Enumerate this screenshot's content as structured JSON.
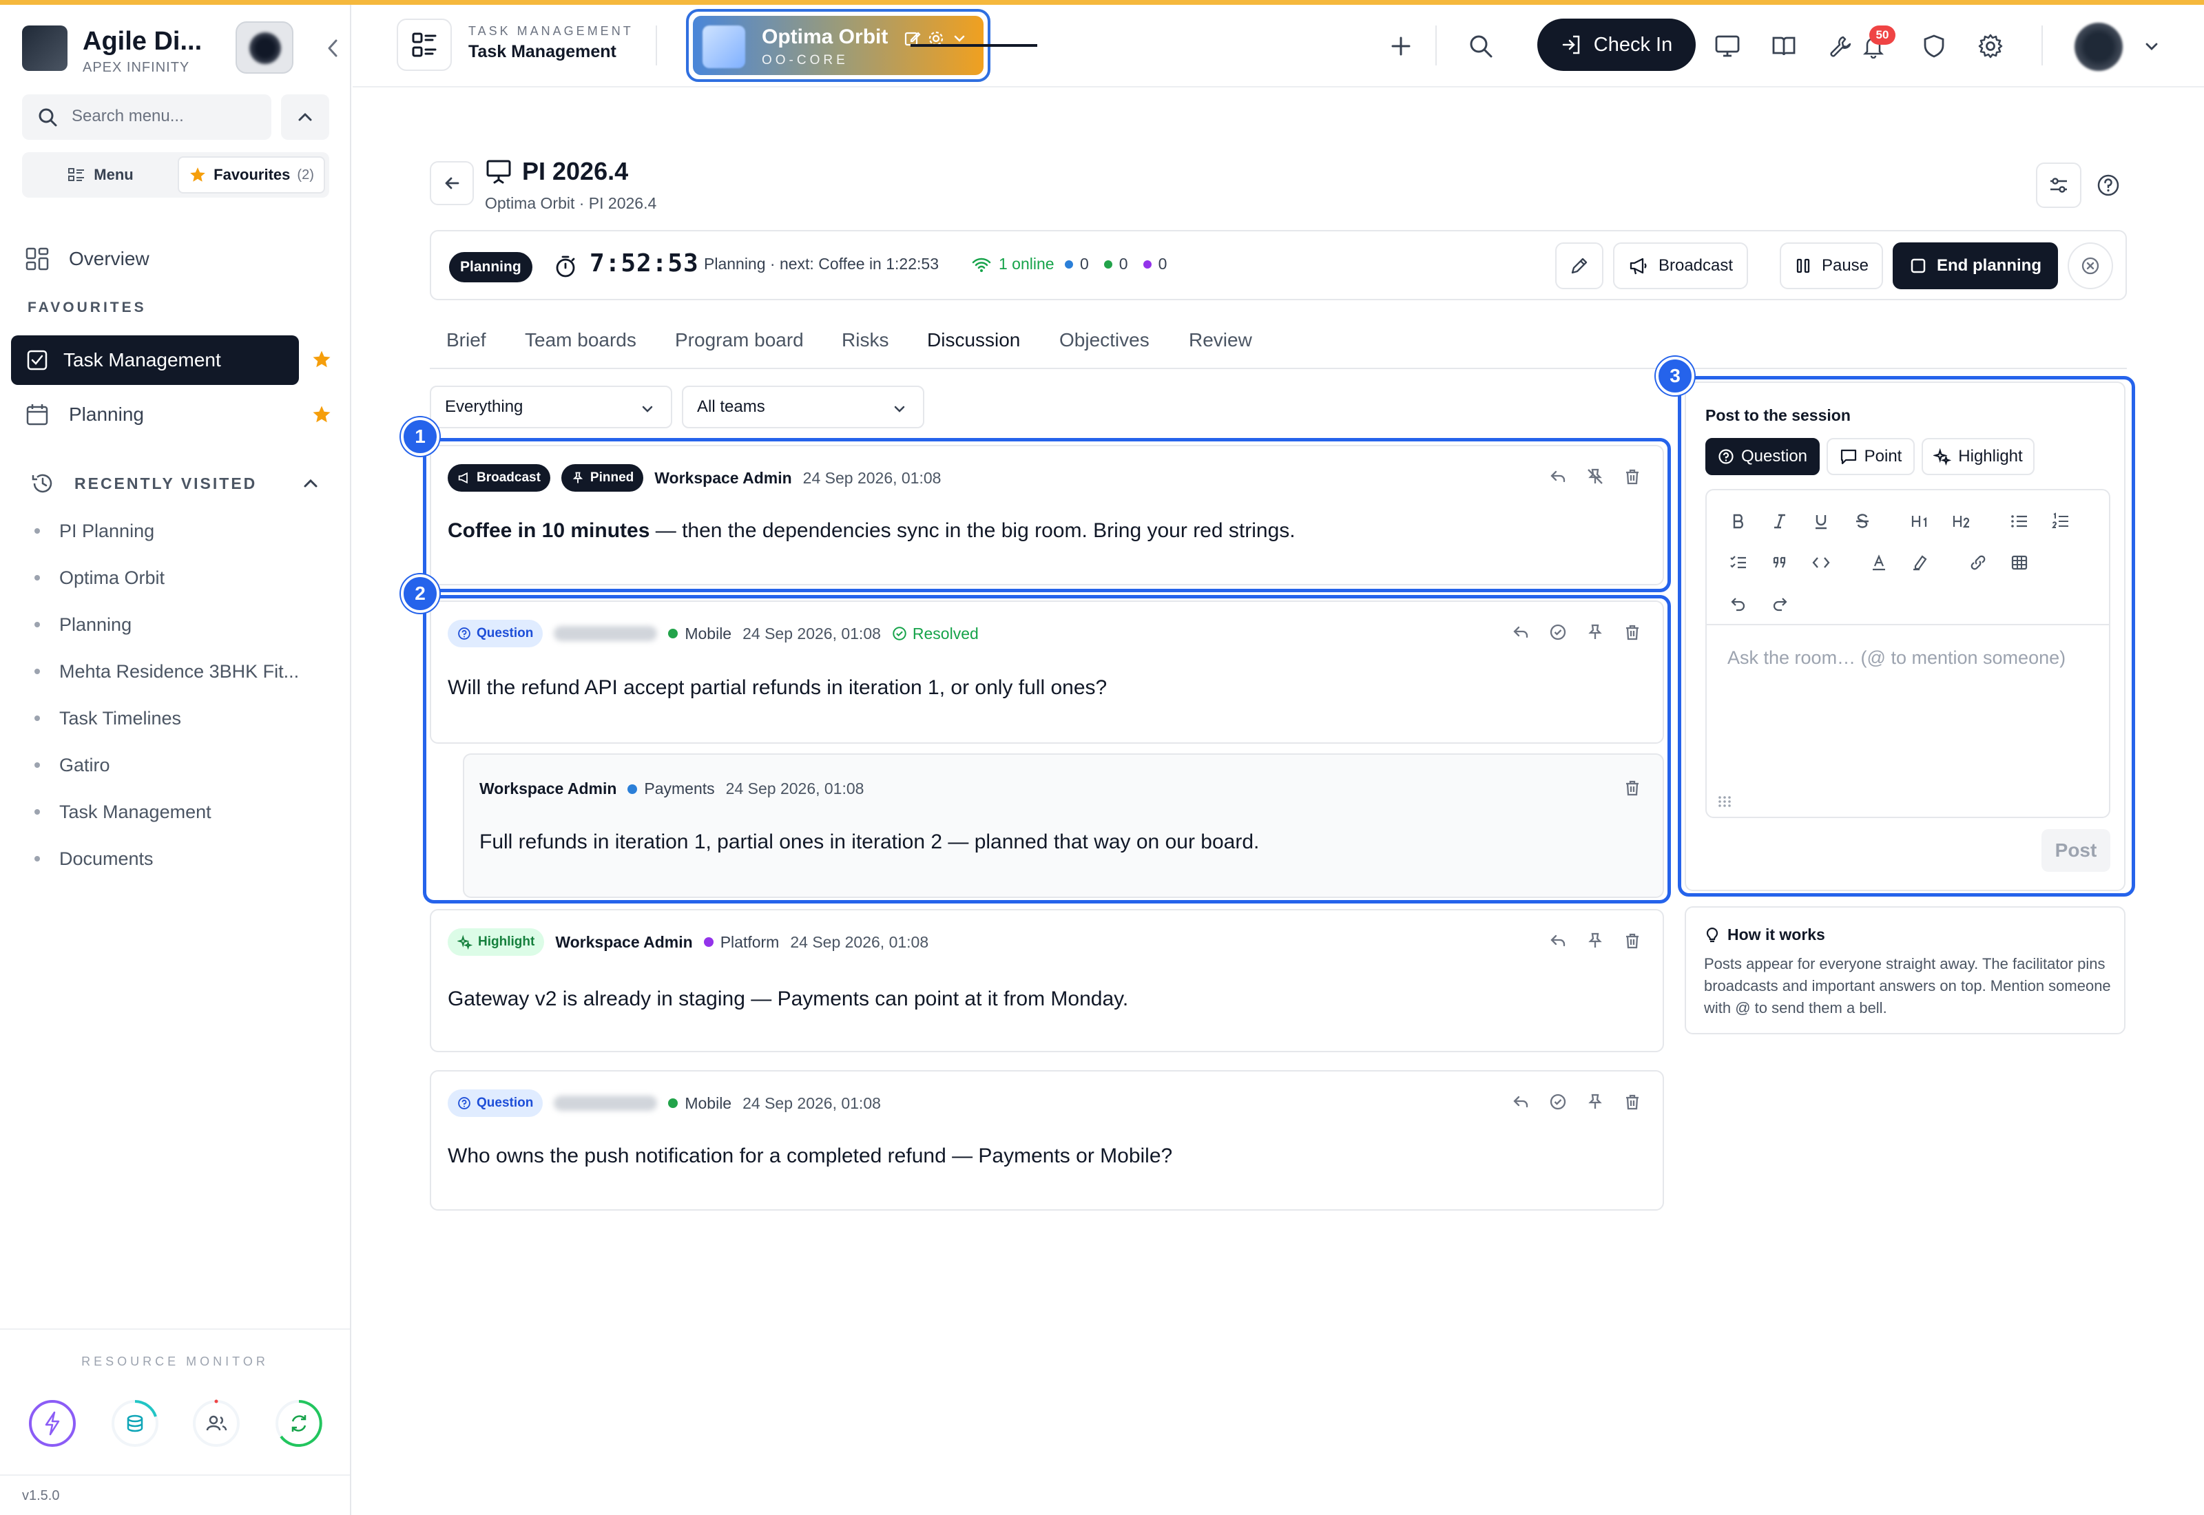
{
  "sidebar": {
    "brand_name": "Agile Di...",
    "brand_sub": "APEX INFINITY",
    "search_placeholder": "Search menu...",
    "seg_menu": "Menu",
    "seg_favourites": "Favourites",
    "fav_count": "(2)",
    "overview": "Overview",
    "favourites_label": "FAVOURITES",
    "fav_items": [
      "Task Management",
      "Planning"
    ],
    "recent_label": "RECENTLY VISITED",
    "recent": [
      "PI Planning",
      "Optima Orbit",
      "Planning",
      "Mehta Residence 3BHK Fit...",
      "Task Timelines",
      "Gatiro",
      "Task Management",
      "Documents"
    ],
    "resource_label": "RESOURCE MONITOR",
    "version": "v1.5.0"
  },
  "header": {
    "module_sub": "TASK MANAGEMENT",
    "module_title": "Task Management",
    "workspace_name": "Optima Orbit",
    "workspace_code": "OO-CORE",
    "checkin": "Check In",
    "notif_count": "50"
  },
  "page": {
    "title": "PI 2026.4",
    "breadcrumb": "Optima Orbit · PI 2026.4"
  },
  "status": {
    "state": "Planning",
    "timer": "7:52:53",
    "text": "Planning · next: Coffee in 1:22:53",
    "online": "1 online",
    "counts": [
      "0",
      "0",
      "0"
    ],
    "buttons": {
      "broadcast": "Broadcast",
      "pause": "Pause",
      "end": "End planning"
    }
  },
  "tabs": [
    "Brief",
    "Team boards",
    "Program board",
    "Risks",
    "Discussion",
    "Objectives",
    "Review"
  ],
  "filters": {
    "type": "Everything",
    "team": "All teams"
  },
  "messages": [
    {
      "chips": [
        "Broadcast",
        "Pinned"
      ],
      "author": "Workspace Admin",
      "time": "24 Sep 2026, 01:08",
      "body_bold": "Coffee in 10 minutes",
      "body": " — then the dependencies sync in the big room. Bring your red strings."
    },
    {
      "chip": "Question",
      "team": "Mobile",
      "time": "24 Sep 2026, 01:08",
      "resolved": "Resolved",
      "body": "Will the refund API accept partial refunds in iteration 1, or only full ones?"
    },
    {
      "author": "Workspace Admin",
      "team": "Payments",
      "time": "24 Sep 2026, 01:08",
      "body": "Full refunds in iteration 1, partial ones in iteration 2 — planned that way on our board."
    },
    {
      "chip": "Highlight",
      "author": "Workspace Admin",
      "team": "Platform",
      "time": "24 Sep 2026, 01:08",
      "body": "Gateway v2 is already in staging — Payments can point at it from Monday."
    },
    {
      "chip": "Question",
      "team": "Mobile",
      "time": "24 Sep 2026, 01:08",
      "body": "Who owns the push notification for a completed refund — Payments or Mobile?"
    }
  ],
  "post": {
    "title": "Post to the session",
    "types": [
      "Question",
      "Point",
      "Highlight"
    ],
    "placeholder": "Ask the room… (@ to mention someone)",
    "button": "Post"
  },
  "how": {
    "title": "How it works",
    "text": "Posts appear for everyone straight away. The facilitator pins broadcasts and important answers on top. Mention someone with @ to send them a bell."
  },
  "annotations": [
    "1",
    "2",
    "3"
  ],
  "colors": {
    "accent": "#2563eb",
    "dark": "#111827",
    "star": "#f59e0b",
    "green": "#16a34a",
    "blue_dot": "#2b7fd8",
    "green_dot": "#22a34a",
    "purple_dot": "#9333ea"
  }
}
